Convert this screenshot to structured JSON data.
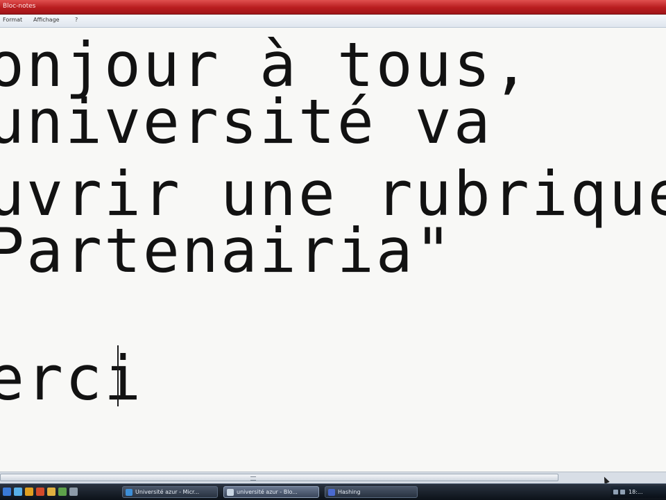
{
  "window": {
    "title": "Bloc-notes"
  },
  "menu": {
    "items": [
      "Format",
      "Affichage",
      "?"
    ]
  },
  "document": {
    "lines": [
      "onjour à tous,",
      "université va",
      "uvrir une rubrique",
      "Partenairia\"",
      "",
      "erci"
    ]
  },
  "taskbar": {
    "tasks": [
      {
        "label": "Université azur - Micr...",
        "icon": "browser-icon",
        "active": false
      },
      {
        "label": "université azur - Blo...",
        "icon": "notepad-icon",
        "active": true
      },
      {
        "label": "Hashing",
        "icon": "app-icon",
        "active": false
      }
    ],
    "tray_text": "18:..."
  },
  "colors": {
    "titlebar": "#b81d1f",
    "editor_bg": "#f8f8f6",
    "taskbar": "#141b24"
  }
}
